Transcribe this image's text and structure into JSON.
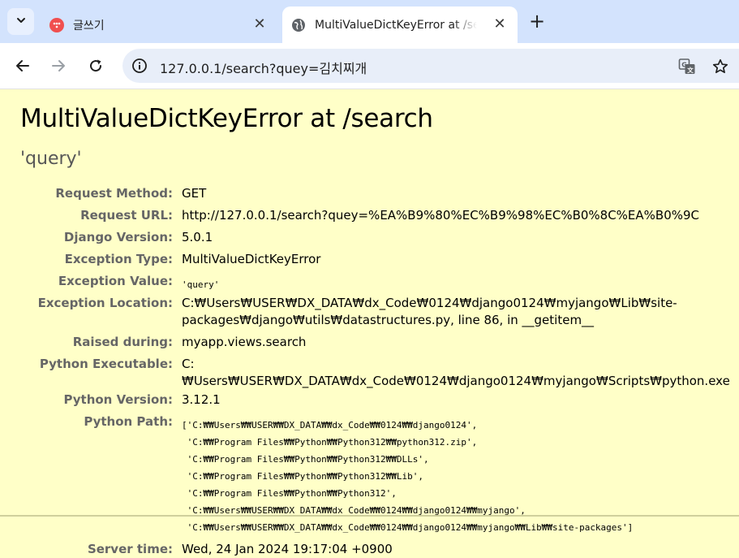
{
  "browser": {
    "tabs": [
      {
        "title": "글쓰기",
        "favicon": "red-circle-icon",
        "active": false
      },
      {
        "title": "MultiValueDictKeyError at /search",
        "favicon": "globe-icon",
        "active": true
      }
    ],
    "url": "127.0.0.1/search?quey=김치찌개",
    "icons": [
      "chevron-down-icon",
      "close-icon",
      "plus-icon",
      "back-icon",
      "forward-icon",
      "reload-icon",
      "site-info-icon",
      "translate-icon",
      "star-icon"
    ]
  },
  "error": {
    "title": "MultiValueDictKeyError at /search",
    "value": "'query'",
    "meta": [
      {
        "label": "Request Method:",
        "value": "GET"
      },
      {
        "label": "Request URL:",
        "value": "http://127.0.0.1/search?quey=%EA%B9%80%EC%B9%98%EC%B0%8C%EA%B0%9C"
      },
      {
        "label": "Django Version:",
        "value": "5.0.1"
      },
      {
        "label": "Exception Type:",
        "value": "MultiValueDictKeyError"
      },
      {
        "label": "Exception Value:",
        "value": "'query'"
      },
      {
        "label": "Exception Location:",
        "value": "C:₩Users₩USER₩DX_DATA₩dx_Code₩0124₩django0124₩myjango₩Lib₩site-packages₩django₩utils₩datastructures.py, line 86, in __getitem__"
      },
      {
        "label": "Raised during:",
        "value": "myapp.views.search"
      },
      {
        "label": "Python Executable:",
        "value": "C:₩Users₩USER₩DX_DATA₩dx_Code₩0124₩django0124₩myjango₩Scripts₩python.exe"
      },
      {
        "label": "Python Version:",
        "value": "3.12.1"
      },
      {
        "label": "Python Path:",
        "value": "['C:₩₩Users₩₩USER₩₩DX_DATA₩₩dx_Code₩₩0124₩₩django0124',\n 'C:₩₩Program Files₩₩Python₩₩Python312₩₩python312.zip',\n 'C:₩₩Program Files₩₩Python₩₩Python312₩₩DLLs',\n 'C:₩₩Program Files₩₩Python₩₩Python312₩₩Lib',\n 'C:₩₩Program Files₩₩Python₩₩Python312',\n 'C:₩₩Users₩₩USER₩₩DX_DATA₩₩dx_Code₩₩0124₩₩django0124₩₩myjango',\n 'C:₩₩Users₩₩USER₩₩DX_DATA₩₩dx_Code₩₩0124₩₩django0124₩₩myjango₩₩Lib₩₩site-packages']"
      },
      {
        "label": "Server time:",
        "value": "Wed, 24 Jan 2024 19:17:04 +0900"
      }
    ]
  },
  "colors": {
    "summary_bg": "#ffffc8",
    "tabstrip_bg": "#d3e3fd",
    "label_gray": "#666666"
  }
}
